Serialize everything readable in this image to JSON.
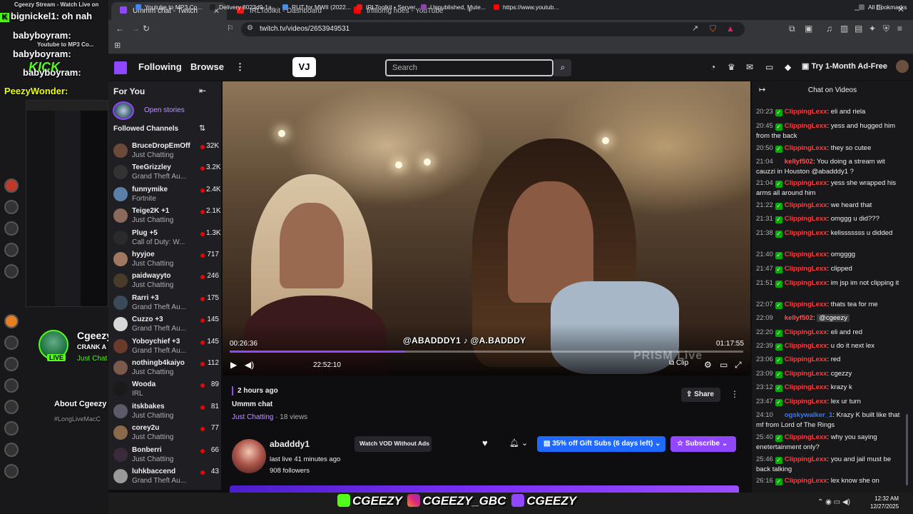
{
  "overlay": {
    "chat_lines": [
      {
        "user": "bignickel1",
        "text": ": oh nah"
      },
      {
        "user": "babyboyram",
        "text": ":"
      },
      {
        "user": "babyboyram",
        "text": ":"
      },
      {
        "user": "babyboyram",
        "text": ":"
      },
      {
        "user": "PeezyWonder",
        "text": ":"
      }
    ],
    "kick_text": "KICK",
    "mini_stream_title": "Cgeezy Stream - Watch Live on",
    "mini_tab": "Youtube to MP3 Co...",
    "streamer_short": "Cgeezy",
    "streamer_cat": "CRANK A",
    "just_chat": "Just Chat",
    "about": "About Cgeezy",
    "hashtag": "#LongLiveMacC",
    "live_label": "LIVE"
  },
  "browser": {
    "tabs": [
      {
        "label": "Ummm chat - Twitch",
        "active": true,
        "color": "#9147ff"
      },
      {
        "label": "IRLToolkit - Dashboard",
        "active": false,
        "color": "#e91916"
      },
      {
        "label": "trfiliomg hoes - YouTube",
        "active": false,
        "color": "#ff0000"
      }
    ],
    "url": "twitch.tv/videos/2653949531",
    "bookmarks": [
      {
        "label": "Youtube to MP3 Co...",
        "color": "#4285f4"
      },
      {
        "label": "Delivery 8023d9-1a...",
        "color": "#222222"
      },
      {
        "label": "RUT for MWII (2022...",
        "color": "#4a90e2"
      },
      {
        "label": "IRLToolkit • Server",
        "color": "#e91916"
      },
      {
        "label": "Unpublished, Mute...",
        "color": "#8e44ad"
      },
      {
        "label": "https://www.youtub...",
        "color": "#ff0000"
      }
    ],
    "all_bookmarks": "All Bookmarks"
  },
  "twitch_nav": {
    "following": "Following",
    "browse": "Browse",
    "search_placeholder": "Search",
    "vj_logo": "VJ",
    "ad_free": "Try 1-Month Ad-Free"
  },
  "sidebar": {
    "for_you": "For You",
    "open_stories": "Open stories",
    "followed": "Followed Channels",
    "channels": [
      {
        "name": "BruceDropEmOff",
        "game": "Just Chatting",
        "viewers": "32K",
        "color": "#6b4a3a"
      },
      {
        "name": "TeeGrizzley",
        "game": "Grand Theft Au...",
        "viewers": "3.2K",
        "color": "#333333"
      },
      {
        "name": "funnymike",
        "game": "Fortnite",
        "viewers": "2.4K",
        "color": "#5a7fa8"
      },
      {
        "name": "Teige2K +1",
        "game": "Just Chatting",
        "viewers": "2.1K",
        "color": "#8a6a5a"
      },
      {
        "name": "Plug +5",
        "game": "Call of Duty: W...",
        "viewers": "1.3K",
        "color": "#2a2a2a"
      },
      {
        "name": "hyyjoe",
        "game": "Just Chatting",
        "viewers": "717",
        "color": "#a07860"
      },
      {
        "name": "paidwayyto",
        "game": "Just Chatting",
        "viewers": "246",
        "color": "#4a3a2a"
      },
      {
        "name": "Rarri +3",
        "game": "Grand Theft Au...",
        "viewers": "175",
        "color": "#3a4a5a"
      },
      {
        "name": "Cuzzo +3",
        "game": "Grand Theft Au...",
        "viewers": "145",
        "color": "#d8d8d8"
      },
      {
        "name": "Yoboychief +3",
        "game": "Grand Theft Au...",
        "viewers": "145",
        "color": "#6a3a2a"
      },
      {
        "name": "nothingb4kaiyo",
        "game": "Just Chatting",
        "viewers": "112",
        "color": "#7a5a4a"
      },
      {
        "name": "Wooda",
        "game": "IRL",
        "viewers": "89",
        "color": "#1a1a1a"
      },
      {
        "name": "itskbakes",
        "game": "Just Chatting",
        "viewers": "81",
        "color": "#5a5a6a"
      },
      {
        "name": "corey2u",
        "game": "Just Chatting",
        "viewers": "77",
        "color": "#8a6a4a"
      },
      {
        "name": "Bonberri",
        "game": "Just Chatting",
        "viewers": "66",
        "color": "#3a2a3a"
      },
      {
        "name": "luhkbaccend",
        "game": "Grand Theft Au...",
        "viewers": "43",
        "color": "#9a9a9a"
      }
    ]
  },
  "video": {
    "elapsed": "00:26:36",
    "duration": "01:17:55",
    "clock": "22:52:10",
    "progress": 0.34,
    "handles": "@ABADDDY1 ♪ @A.BADDDY",
    "clip": "Clip",
    "watermark": "PRISM Live"
  },
  "vod": {
    "ago": "2 hours ago",
    "title": "Ummm chat",
    "category": "Just Chatting",
    "views": "18 views",
    "share": "Share",
    "streamer": "abadddy1",
    "last_live": "last live 41 minutes ago",
    "followers": "908 followers",
    "vod_no_ads": "Watch VOD Without Ads",
    "gift_subs": "35% off Gift Subs (6 days left)",
    "subscribe": "Subscribe"
  },
  "chat": {
    "title": "Chat on Videos",
    "messages": [
      {
        "ts": "20:23",
        "user": "ClippingLexx",
        "color": "#ff3b3b",
        "badge": true,
        "text": ": eli and riela"
      },
      {
        "ts": "20:45",
        "user": "ClippingLexx",
        "color": "#ff3b3b",
        "badge": true,
        "text": ": yess and hugged him from the back"
      },
      {
        "ts": "20:50",
        "user": "ClippingLexx",
        "color": "#ff3b3b",
        "badge": true,
        "text": ": they so cutee"
      },
      {
        "ts": "21:04",
        "user": "kellyf502",
        "color": "#ff4f4f",
        "badge": false,
        "text": ": You doing a stream wit cauzzi in Houston @abadddy1 ?"
      },
      {
        "ts": "21:04",
        "user": "ClippingLexx",
        "color": "#ff3b3b",
        "badge": true,
        "text": ": yess she wrapped his arms all around him"
      },
      {
        "ts": "21:22",
        "user": "ClippingLexx",
        "color": "#ff3b3b",
        "badge": true,
        "text": ": we heard that"
      },
      {
        "ts": "21:31",
        "user": "ClippingLexx",
        "color": "#ff3b3b",
        "badge": true,
        "text": ": omggg u did???"
      },
      {
        "ts": "21:38",
        "user": "ClippingLexx",
        "color": "#ff3b3b",
        "badge": true,
        "text": ": kelisssssss u didded"
      },
      {
        "ts": "21:40",
        "user": "ClippingLexx",
        "color": "#ff3b3b",
        "badge": true,
        "text": ": omgggg"
      },
      {
        "ts": "21:47",
        "user": "ClippingLexx",
        "color": "#ff3b3b",
        "badge": true,
        "text": ": clipped"
      },
      {
        "ts": "21:51",
        "user": "ClippingLexx",
        "color": "#ff3b3b",
        "badge": true,
        "text": ": im jsp im not clipping it"
      },
      {
        "ts": "22:07",
        "user": "ClippingLexx",
        "color": "#ff3b3b",
        "badge": true,
        "text": ": thats tea for me"
      },
      {
        "ts": "22:09",
        "user": "kellyf502",
        "color": "#ff4f4f",
        "badge": false,
        "text": ": ",
        "mention": "@cgeezy"
      },
      {
        "ts": "22:20",
        "user": "ClippingLexx",
        "color": "#ff3b3b",
        "badge": true,
        "text": ": eli and red"
      },
      {
        "ts": "22:39",
        "user": "ClippingLexx",
        "color": "#ff3b3b",
        "badge": true,
        "text": ": u do it next lex"
      },
      {
        "ts": "23:06",
        "user": "ClippingLexx",
        "color": "#ff3b3b",
        "badge": true,
        "text": ": red"
      },
      {
        "ts": "23:09",
        "user": "ClippingLexx",
        "color": "#ff3b3b",
        "badge": true,
        "text": ": cgezzy"
      },
      {
        "ts": "23:12",
        "user": "ClippingLexx",
        "color": "#ff3b3b",
        "badge": true,
        "text": ": krazy k"
      },
      {
        "ts": "23:47",
        "user": "ClippingLexx",
        "color": "#ff3b3b",
        "badge": true,
        "text": ": lex ur turn"
      },
      {
        "ts": "24:10",
        "user": "ogskywalker_1",
        "color": "#2e7bff",
        "badge": false,
        "text": ": Krazy K built like that mf from Lord of The Rings"
      },
      {
        "ts": "25:40",
        "user": "ClippingLexx",
        "color": "#ff3b3b",
        "badge": true,
        "text": ": why you saying enetertainment only?"
      },
      {
        "ts": "25:46",
        "user": "ClippingLexx",
        "color": "#ff3b3b",
        "badge": true,
        "text": ": you and jail must be back talking"
      },
      {
        "ts": "26:16",
        "user": "ClippingLexx",
        "color": "#ff3b3b",
        "badge": true,
        "text": ": lex know she on"
      }
    ]
  },
  "socials": {
    "kick": "CGEEZY",
    "instagram": "CGEEZY_GBC",
    "twitch": "CGEEZY"
  },
  "taskbar": {
    "time": "12:32 AM",
    "date": "12/27/2025"
  }
}
